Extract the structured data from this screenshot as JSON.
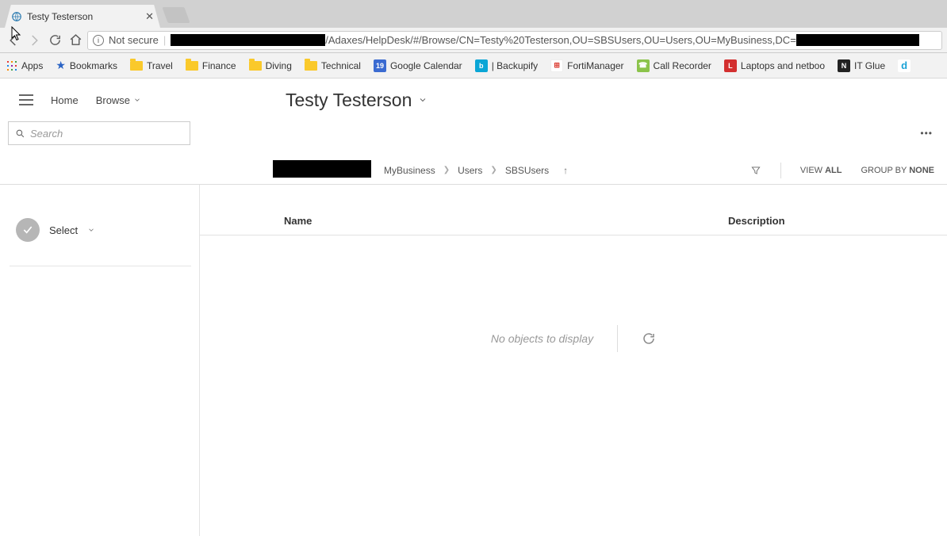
{
  "tab": {
    "title": "Testy Testerson"
  },
  "address": {
    "security_label": "Not secure",
    "url_mid": "/Adaxes/HelpDesk/#/Browse/CN=Testy%20Testerson,OU=SBSUsers,OU=Users,OU=MyBusiness,DC="
  },
  "bookmarks": {
    "apps": "Apps",
    "bookmarks": "Bookmarks",
    "travel": "Travel",
    "finance": "Finance",
    "diving": "Diving",
    "technical": "Technical",
    "gcal": "Google Calendar",
    "backupify": "| Backupify",
    "forti": "FortiManager",
    "callrec": "Call Recorder",
    "laptops": "Laptops and netboo",
    "itglue": "IT Glue"
  },
  "nav": {
    "home": "Home",
    "browse": "Browse"
  },
  "page_title": "Testy Testerson",
  "search": {
    "placeholder": "Search"
  },
  "breadcrumb": {
    "b1": "MyBusiness",
    "b2": "Users",
    "b3": "SBSUsers"
  },
  "toolbar": {
    "view_label": "VIEW ",
    "view_value": "ALL",
    "group_label": "GROUP BY ",
    "group_value": "NONE"
  },
  "sidebar": {
    "select": "Select"
  },
  "table": {
    "col_name": "Name",
    "col_desc": "Description",
    "empty": "No objects to display"
  }
}
